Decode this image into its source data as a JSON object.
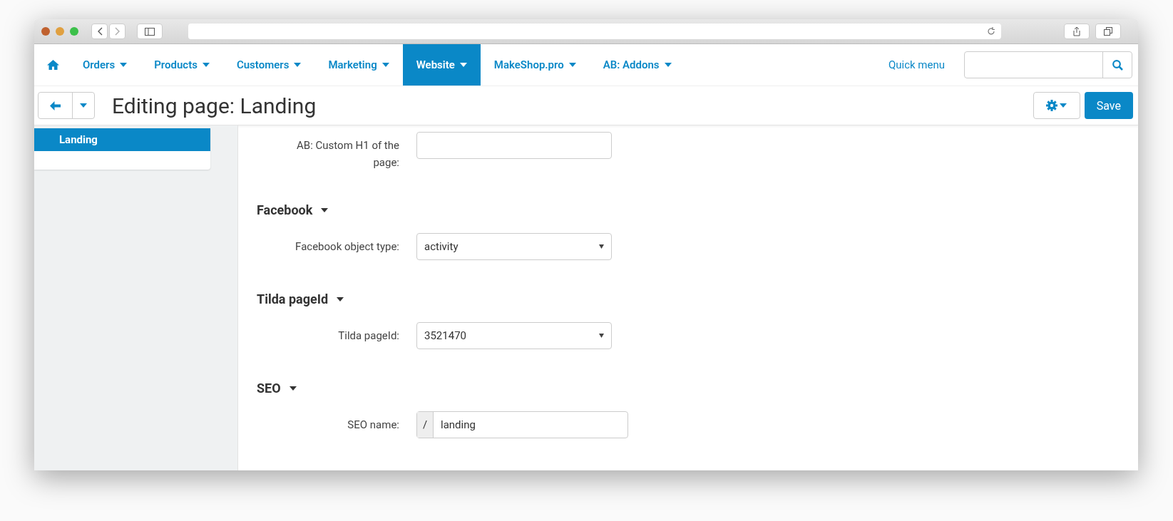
{
  "nav": {
    "items": [
      {
        "label": "Orders",
        "selected": false
      },
      {
        "label": "Products",
        "selected": false
      },
      {
        "label": "Customers",
        "selected": false
      },
      {
        "label": "Marketing",
        "selected": false
      },
      {
        "label": "Website",
        "selected": true
      },
      {
        "label": "MakeShop.pro",
        "selected": false
      },
      {
        "label": "AB: Addons",
        "selected": false
      }
    ],
    "quick_menu": "Quick menu"
  },
  "header": {
    "title": "Editing page: Landing",
    "save": "Save"
  },
  "sidebar": {
    "items": [
      {
        "label": "Landing",
        "selected": true
      }
    ]
  },
  "sections": [
    {
      "fields": [
        {
          "kind": "text",
          "label": "AB: Custom H1 of the page:"
        }
      ]
    },
    {
      "heading": "Facebook",
      "fields": [
        {
          "kind": "select",
          "label": "Facebook object type:",
          "value": "activity"
        }
      ]
    },
    {
      "heading": "Tilda pageId",
      "fields": [
        {
          "kind": "select",
          "label": "Tilda pageId:",
          "value": "3521470"
        }
      ]
    },
    {
      "heading": "SEO",
      "fields": [
        {
          "kind": "prefixed",
          "label": "SEO name:",
          "prefix": "/",
          "value": "landing"
        }
      ]
    }
  ]
}
